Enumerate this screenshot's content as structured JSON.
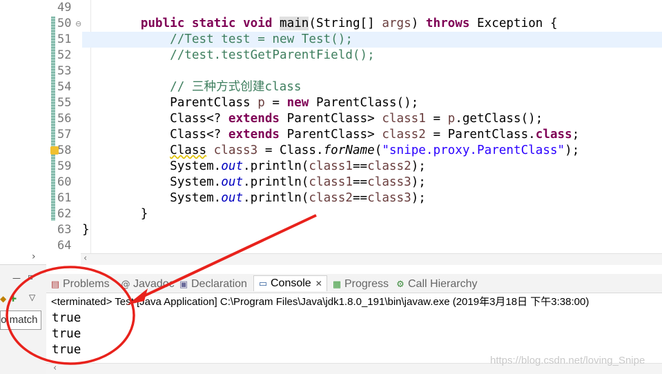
{
  "editor": {
    "lines": [
      {
        "num": "49",
        "segments": []
      },
      {
        "num": "50",
        "segments": [
          {
            "t": "        "
          },
          {
            "t": "public",
            "c": "kw"
          },
          {
            "t": " "
          },
          {
            "t": "static",
            "c": "kw"
          },
          {
            "t": " "
          },
          {
            "t": "void",
            "c": "kw"
          },
          {
            "t": " "
          },
          {
            "t": "main",
            "c": "match-box"
          },
          {
            "t": "(String[] "
          },
          {
            "t": "args",
            "c": "var"
          },
          {
            "t": ") "
          },
          {
            "t": "throws",
            "c": "kw"
          },
          {
            "t": " Exception {"
          }
        ]
      },
      {
        "num": "51",
        "segments": [
          {
            "t": "            "
          },
          {
            "t": "//Test test = new Test();",
            "c": "cm"
          }
        ]
      },
      {
        "num": "52",
        "segments": [
          {
            "t": "            "
          },
          {
            "t": "//test.testGetParentField();",
            "c": "cm"
          }
        ]
      },
      {
        "num": "53",
        "segments": []
      },
      {
        "num": "54",
        "segments": [
          {
            "t": "            "
          },
          {
            "t": "// 三种方式创建class",
            "c": "cm"
          }
        ]
      },
      {
        "num": "55",
        "segments": [
          {
            "t": "            ParentClass "
          },
          {
            "t": "p",
            "c": "var"
          },
          {
            "t": " = "
          },
          {
            "t": "new",
            "c": "kw"
          },
          {
            "t": " ParentClass();"
          }
        ]
      },
      {
        "num": "56",
        "segments": [
          {
            "t": "            Class<? "
          },
          {
            "t": "extends",
            "c": "kw"
          },
          {
            "t": " ParentClass> "
          },
          {
            "t": "class1",
            "c": "var"
          },
          {
            "t": " = "
          },
          {
            "t": "p",
            "c": "var"
          },
          {
            "t": ".getClass();"
          }
        ]
      },
      {
        "num": "57",
        "segments": [
          {
            "t": "            Class<? "
          },
          {
            "t": "extends",
            "c": "kw"
          },
          {
            "t": " ParentClass> "
          },
          {
            "t": "class2",
            "c": "var"
          },
          {
            "t": " = ParentClass."
          },
          {
            "t": "class",
            "c": "kw"
          },
          {
            "t": ";"
          }
        ]
      },
      {
        "num": "58",
        "segments": [
          {
            "t": "            "
          },
          {
            "t": "Class",
            "c": "squiggle"
          },
          {
            "t": " "
          },
          {
            "t": "class3",
            "c": "var"
          },
          {
            "t": " = Class."
          },
          {
            "t": "forName",
            "c": "it"
          },
          {
            "t": "("
          },
          {
            "t": "\"snipe.proxy.ParentClass\"",
            "c": "str"
          },
          {
            "t": ");"
          }
        ]
      },
      {
        "num": "59",
        "segments": [
          {
            "t": "            System."
          },
          {
            "t": "out",
            "c": "fld it"
          },
          {
            "t": ".println("
          },
          {
            "t": "class1",
            "c": "var"
          },
          {
            "t": "=="
          },
          {
            "t": "class2",
            "c": "var"
          },
          {
            "t": ");"
          }
        ]
      },
      {
        "num": "60",
        "segments": [
          {
            "t": "            System."
          },
          {
            "t": "out",
            "c": "fld it"
          },
          {
            "t": ".println("
          },
          {
            "t": "class1",
            "c": "var"
          },
          {
            "t": "=="
          },
          {
            "t": "class3",
            "c": "var"
          },
          {
            "t": ");"
          }
        ]
      },
      {
        "num": "61",
        "segments": [
          {
            "t": "            System."
          },
          {
            "t": "out",
            "c": "fld it"
          },
          {
            "t": ".println("
          },
          {
            "t": "class2",
            "c": "var"
          },
          {
            "t": "=="
          },
          {
            "t": "class3",
            "c": "var"
          },
          {
            "t": ");"
          }
        ]
      },
      {
        "num": "62",
        "segments": [
          {
            "t": "        }"
          }
        ]
      },
      {
        "num": "63",
        "segments": [
          {
            "t": "}"
          }
        ]
      },
      {
        "num": "64",
        "segments": []
      }
    ]
  },
  "tabs": {
    "problems": "Problems",
    "javadoc": "Javadoc",
    "declaration": "Declaration",
    "console": "Console",
    "progress": "Progress",
    "call_hierarchy": "Call Hierarchy"
  },
  "console": {
    "status": "<terminated> Test [Java Application] C:\\Program Files\\Java\\jdk1.8.0_191\\bin\\javaw.exe (2019年3月18日 下午3:38:00)",
    "output": [
      "true",
      "true",
      "true"
    ]
  },
  "left_panel": {
    "search_fragment": "to match"
  },
  "watermark": "https://blog.csdn.net/loving_Snipe",
  "colors": {
    "keyword": "#7f0055",
    "comment": "#3f7f5f",
    "string": "#2a00ff",
    "annotation_red": "#e8221c"
  }
}
